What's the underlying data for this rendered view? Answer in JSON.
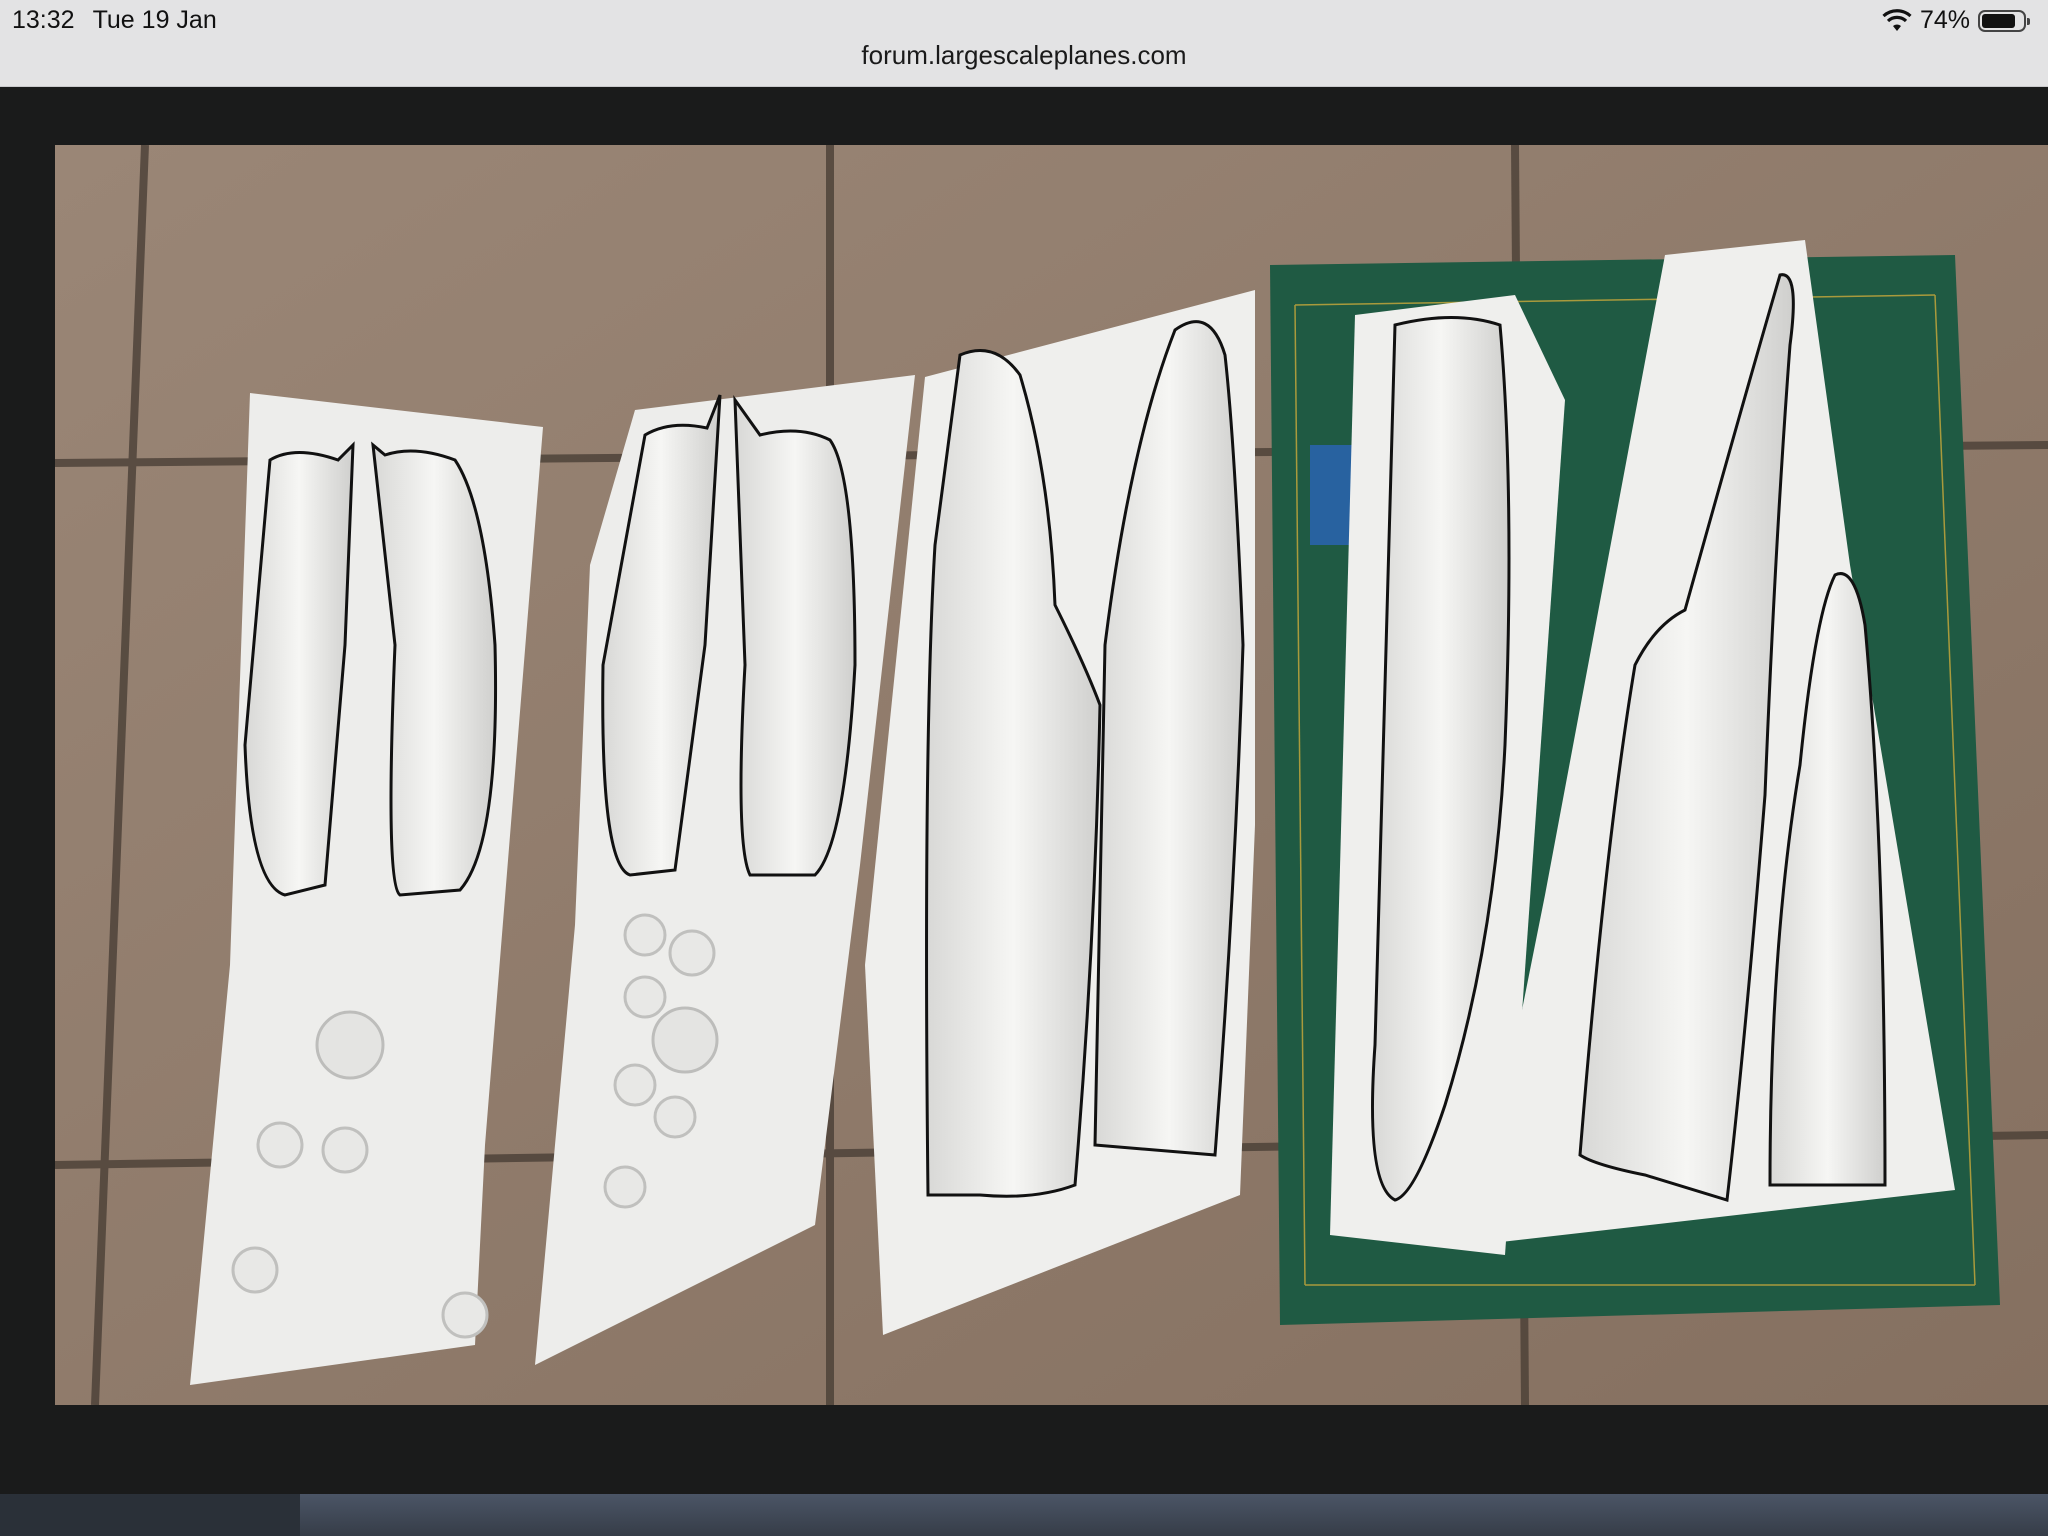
{
  "status": {
    "time": "13:32",
    "date": "Tue 19 Jan",
    "battery": "74%",
    "battery_level": 0.74
  },
  "browser": {
    "url": "forum.largescaleplanes.com"
  },
  "icons": {
    "wifi": "wifi-icon",
    "battery": "battery-icon"
  }
}
